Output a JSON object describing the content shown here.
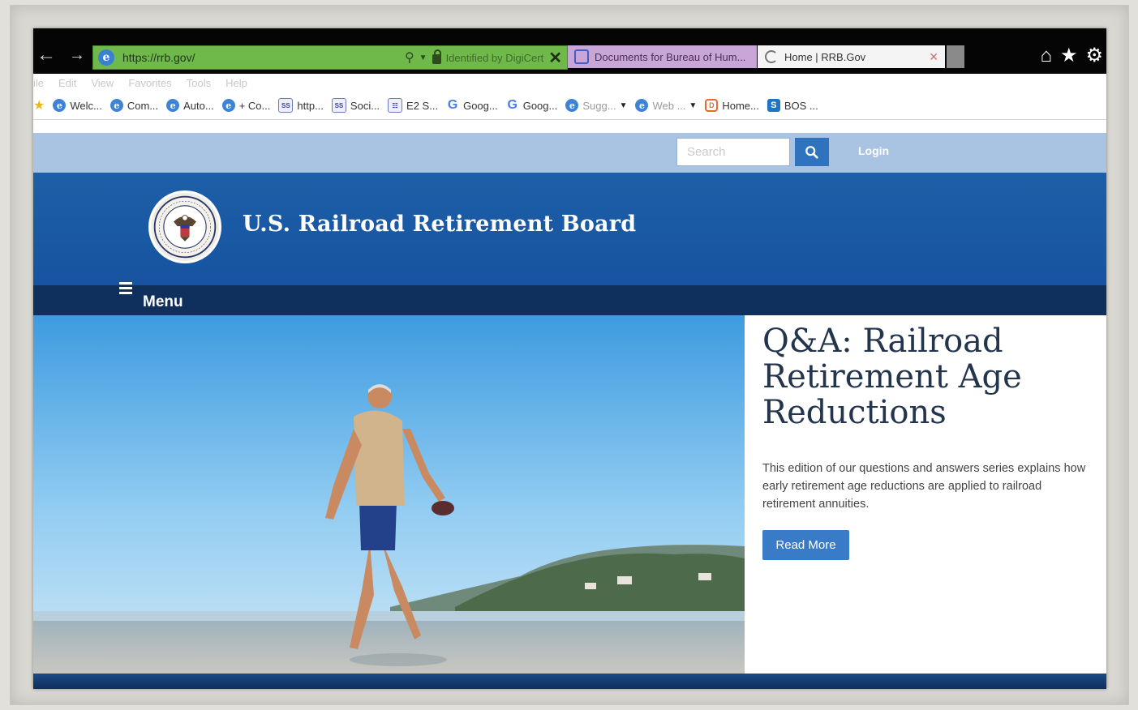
{
  "browser": {
    "address": {
      "url": "https://rrb.gov/",
      "cert_text": "Identified by DigiCert"
    },
    "tabs": [
      {
        "label": "Documents for Bureau of Hum..."
      },
      {
        "label": "Home | RRB.Gov"
      }
    ],
    "menu": [
      "File",
      "Edit",
      "View",
      "Favorites",
      "Tools",
      "Help"
    ],
    "favorites": [
      {
        "label": "Welc...",
        "icon": "ie-icon"
      },
      {
        "label": "Com...",
        "icon": "ie-icon"
      },
      {
        "label": "Auto...",
        "icon": "ie-icon"
      },
      {
        "label": "+ Co...",
        "icon": "ie-icon"
      },
      {
        "label": "http...",
        "icon": "document-icon"
      },
      {
        "label": "Soci...",
        "icon": "document-icon"
      },
      {
        "label": "E2 S...",
        "icon": "document-icon"
      },
      {
        "label": "Goog...",
        "icon": "google-icon"
      },
      {
        "label": "Goog...",
        "icon": "google-icon"
      },
      {
        "label": "Sugg...",
        "icon": "ie-icon"
      },
      {
        "label": "Web ...",
        "icon": "ie-icon"
      },
      {
        "label": "Home...",
        "icon": "delve-icon"
      },
      {
        "label": "BOS ...",
        "icon": "sharepoint-icon"
      }
    ]
  },
  "site": {
    "search": {
      "placeholder": "Search"
    },
    "login_label": "Login",
    "title": "U.S. Railroad Retirement Board",
    "menu_label": "Menu",
    "feature": {
      "title": "Q&A: Railroad Retirement Age Reductions",
      "body": "This edition of our questions and answers series explains how early retirement age reductions are applied to railroad retirement annuities.",
      "button": "Read More"
    },
    "colors": {
      "banner": "#1d5fa8",
      "utility_bar": "#a9c3e3",
      "menu_bar": "#0f305c",
      "button": "#3a7bc8",
      "heading": "#23344d"
    }
  }
}
